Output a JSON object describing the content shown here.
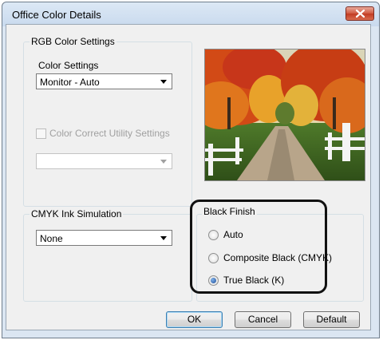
{
  "window": {
    "title": "Office Color Details"
  },
  "rgb": {
    "group_label": "RGB Color Settings",
    "color_settings_label": "Color Settings",
    "color_settings_value": "Monitor - Auto",
    "utility_checkbox_label": "Color Correct Utility Settings",
    "utility_checked": false,
    "utility_combo_value": ""
  },
  "cmyk": {
    "group_label": "CMYK Ink Simulation",
    "value": "None"
  },
  "black_finish": {
    "group_label": "Black Finish",
    "options": [
      {
        "label": "Auto",
        "selected": false
      },
      {
        "label": "Composite Black (CMYK)",
        "selected": false
      },
      {
        "label": "True Black (K)",
        "selected": true
      }
    ]
  },
  "buttons": {
    "ok": "OK",
    "cancel": "Cancel",
    "default": "Default"
  },
  "preview": {
    "image": "autumn-country-road-photo"
  },
  "colors": {
    "title_bar": "#c9daee",
    "close_button": "#c13b22",
    "dialog_bg": "#f0f0f0",
    "radio_selected": "#1f4f9a"
  }
}
